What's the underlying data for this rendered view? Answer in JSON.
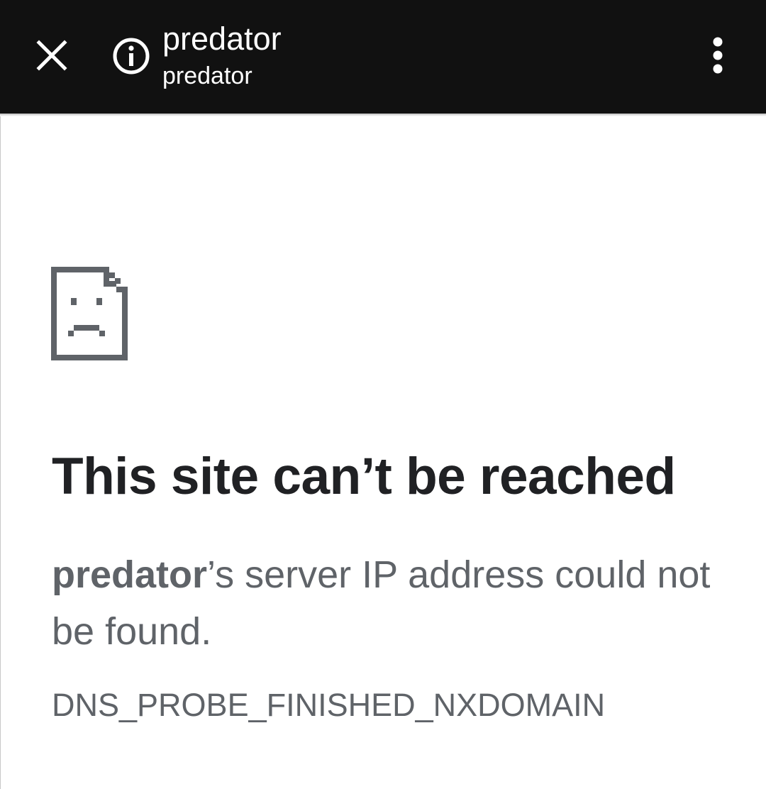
{
  "toolbar": {
    "title": "predator",
    "subtitle": "predator",
    "close_icon": "close-icon",
    "info_icon": "info-icon",
    "menu_icon": "more-vert-icon",
    "background_color": "#111111"
  },
  "error_page": {
    "icon": "sad-document-icon",
    "heading": "This site can’t be reached",
    "host": "predator",
    "message_rest": "’s server IP address could not be found.",
    "code": "DNS_PROBE_FINISHED_NXDOMAIN",
    "heading_color": "#202124",
    "text_color": "#5f6368"
  }
}
